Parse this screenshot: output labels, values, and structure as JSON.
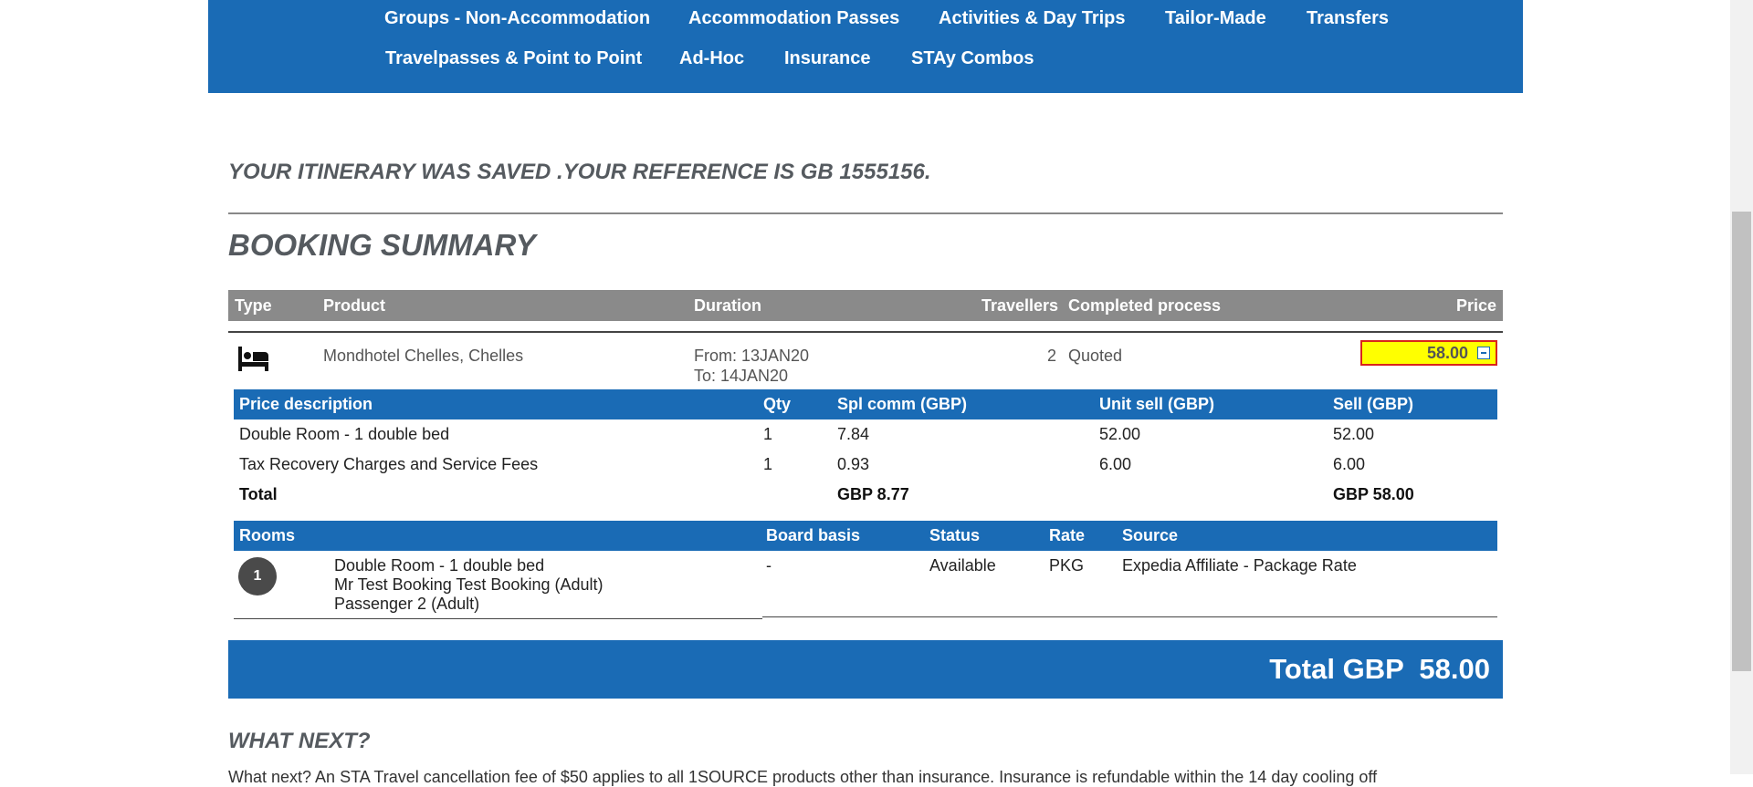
{
  "nav": {
    "row1": [
      "Groups - Non-Accommodation",
      "Accommodation Passes",
      "Activities & Day Trips",
      "Tailor-Made",
      "Transfers"
    ],
    "row2": [
      "Travelpasses & Point to Point",
      "Ad-Hoc",
      "Insurance",
      "STAy Combos"
    ]
  },
  "saved_message": "YOUR ITINERARY WAS SAVED .YOUR REFERENCE IS GB 1555156.",
  "booking_summary": {
    "title": "BOOKING SUMMARY",
    "headers": {
      "type": "Type",
      "product": "Product",
      "duration": "Duration",
      "travellers": "Travellers",
      "completed": "Completed process",
      "price": "Price"
    },
    "product": {
      "type_icon": "bed-icon",
      "name": "Mondhotel Chelles, Chelles",
      "from": "From: 13JAN20",
      "to": "To: 14JAN20",
      "travellers": "2",
      "status": "Quoted",
      "price": "58.00"
    }
  },
  "price_table": {
    "headers": {
      "description": "Price description",
      "qty": "Qty",
      "spl_comm": "Spl comm (GBP)",
      "unit_sell": "Unit sell (GBP)",
      "sell": "Sell (GBP)"
    },
    "rows": [
      {
        "description": "Double Room - 1 double bed",
        "qty": "1",
        "spl_comm": "7.84",
        "unit_sell": "52.00",
        "sell": "52.00"
      },
      {
        "description": "Tax Recovery Charges and Service Fees",
        "qty": "1",
        "spl_comm": "0.93",
        "unit_sell": "6.00",
        "sell": "6.00"
      }
    ],
    "total": {
      "label": "Total",
      "spl_comm": "GBP 8.77",
      "sell": "GBP 58.00"
    }
  },
  "rooms_table": {
    "headers": {
      "rooms": "Rooms",
      "board": "Board basis",
      "status": "Status",
      "rate": "Rate",
      "source": "Source"
    },
    "room": {
      "number": "1",
      "lines": [
        "Double Room - 1 double bed",
        "Mr Test Booking Test Booking (Adult)",
        "Passenger 2 (Adult)"
      ],
      "board": "-",
      "status": "Available",
      "rate": "PKG",
      "source": "Expedia Affiliate - Package Rate"
    }
  },
  "total": "Total GBP  58.00",
  "what_next": {
    "title": "WHAT NEXT?",
    "text": "What next? An STA Travel cancellation fee of $50 applies to all 1SOURCE products other than insurance. Insurance is refundable within the 14 day cooling off"
  },
  "colors": {
    "brand_blue": "#1a6bb5",
    "header_grey": "#8a8a8a",
    "highlight": "#ffff00",
    "highlight_border": "#d9251b"
  }
}
